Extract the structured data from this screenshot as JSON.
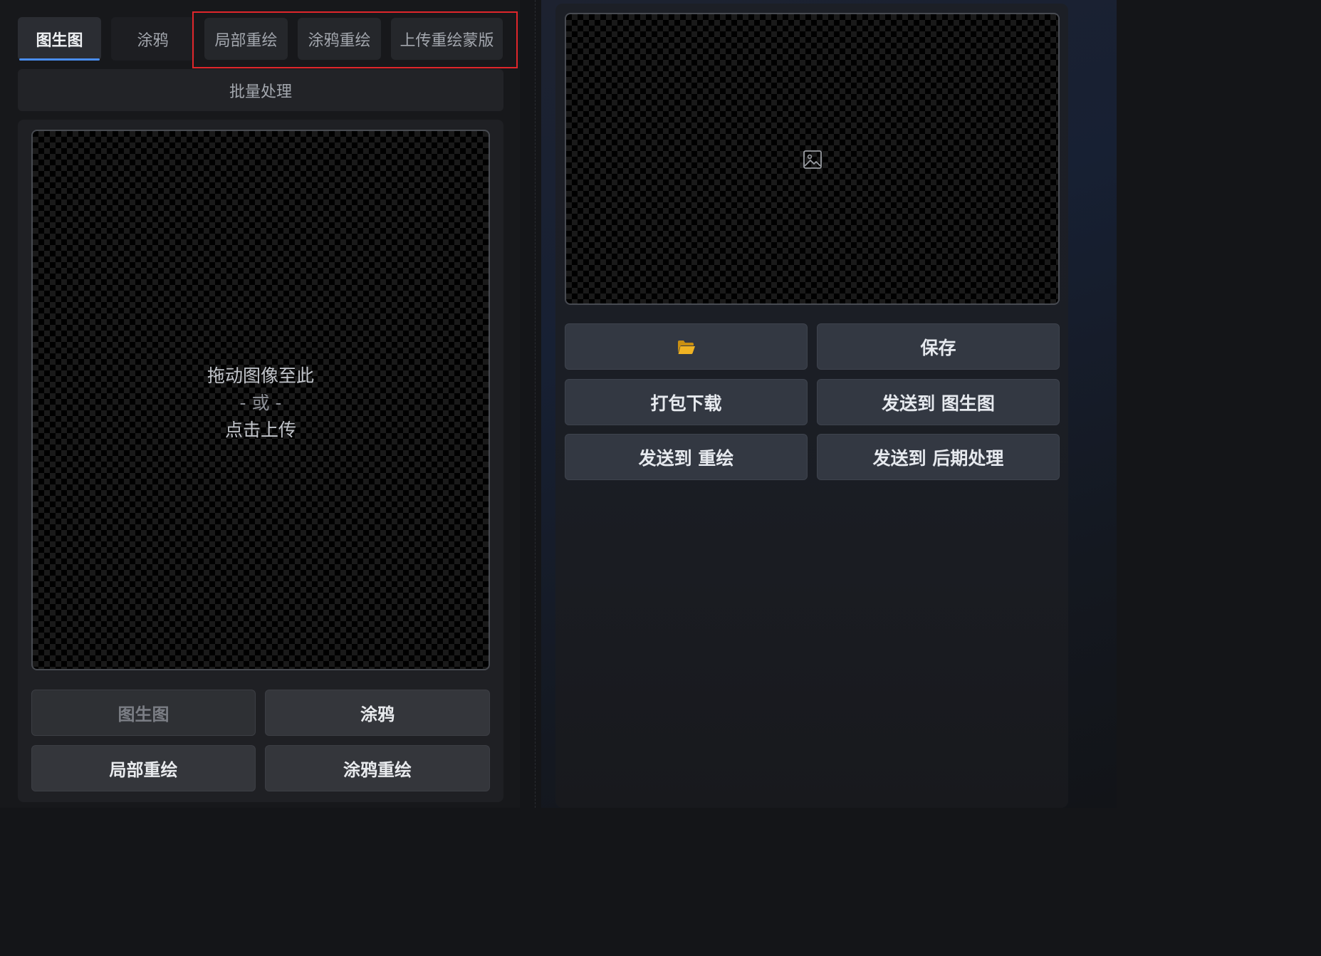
{
  "tabs": [
    {
      "label": "图生图",
      "active": true
    },
    {
      "label": "涂鸦",
      "active": false
    },
    {
      "label": "局部重绘",
      "active": false
    },
    {
      "label": "涂鸦重绘",
      "active": false
    },
    {
      "label": "上传重绘蒙版",
      "active": false
    }
  ],
  "batch_tab": {
    "label": "批量处理"
  },
  "upload": {
    "line1": "拖动图像至此",
    "line2": "- 或 -",
    "line3": "点击上传"
  },
  "send_buttons": {
    "img2img": "图生图",
    "sketch": "涂鸦",
    "inpaint": "局部重绘",
    "inpaint_sketch": "涂鸦重绘"
  },
  "gallery": {
    "icon": "image-placeholder-icon"
  },
  "actions": {
    "open_folder_icon": "folder-icon",
    "save": "保存",
    "zip": "打包下载",
    "send_to_img2img": "发送到 图生图",
    "send_to_inpaint": "发送到 重绘",
    "send_to_extras": "发送到 后期处理"
  },
  "colors": {
    "active_tab_underline": "#4a8df0",
    "highlight_box": "#e0262b",
    "folder_icon": "#f0b323"
  }
}
